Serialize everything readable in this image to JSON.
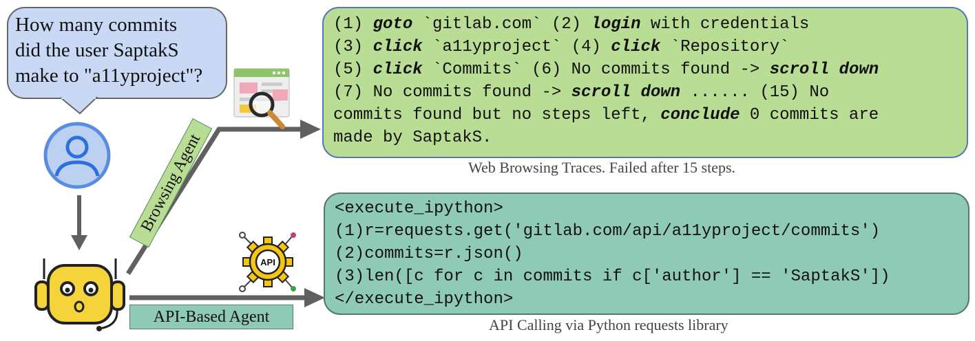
{
  "question": {
    "lines": [
      "How many commits",
      "did the user SaptakS",
      "make to \"a11yproject\"?"
    ]
  },
  "labels": {
    "browsing_agent": "Browsing Agent",
    "api_agent": "API-Based Agent"
  },
  "browsing_trace": {
    "lines": [
      [
        {
          "t": "(1) "
        },
        {
          "t": "goto",
          "k": true
        },
        {
          "t": " `gitlab.com` (2) "
        },
        {
          "t": "login",
          "k": true
        },
        {
          "t": " with credentials"
        }
      ],
      [
        {
          "t": "(3) "
        },
        {
          "t": "click",
          "k": true
        },
        {
          "t": " `a11yproject` (4) "
        },
        {
          "t": "click",
          "k": true
        },
        {
          "t": " `Repository`"
        }
      ],
      [
        {
          "t": "(5) "
        },
        {
          "t": "click",
          "k": true
        },
        {
          "t": " `Commits` (6) No commits found -> "
        },
        {
          "t": "scroll down",
          "k": true
        }
      ],
      [
        {
          "t": "(7) No commits found -> "
        },
        {
          "t": "scroll down",
          "k": true
        },
        {
          "t": " ...... (15) No"
        }
      ],
      [
        {
          "t": "commits found but no steps left, "
        },
        {
          "t": "conclude",
          "k": true
        },
        {
          "t": " 0 commits are"
        }
      ],
      [
        {
          "t": "made by SaptakS."
        }
      ]
    ],
    "caption": "Web Browsing Traces. Failed after 15 steps."
  },
  "api_trace": {
    "lines": [
      "<execute_ipython>",
      "(1)r=requests.get('gitlab.com/api/a11yproject/commits')",
      "(2)commits=r.json()",
      "(3)len([c for c in commits if c['author'] == 'SaptakS'])",
      "</execute_ipython>"
    ],
    "caption": "API Calling via Python requests library"
  },
  "icons": {
    "user": "user-avatar-icon",
    "robot": "robot-agent-icon",
    "browser": "browser-search-icon",
    "api": "api-gear-icon"
  },
  "colors": {
    "bubble": "#c9d9f5",
    "browse_panel": "#b9dd94",
    "api_panel": "#8fcab7",
    "arrow": "#606060",
    "robot": "#f5d33a",
    "gear": "#f5c518"
  }
}
